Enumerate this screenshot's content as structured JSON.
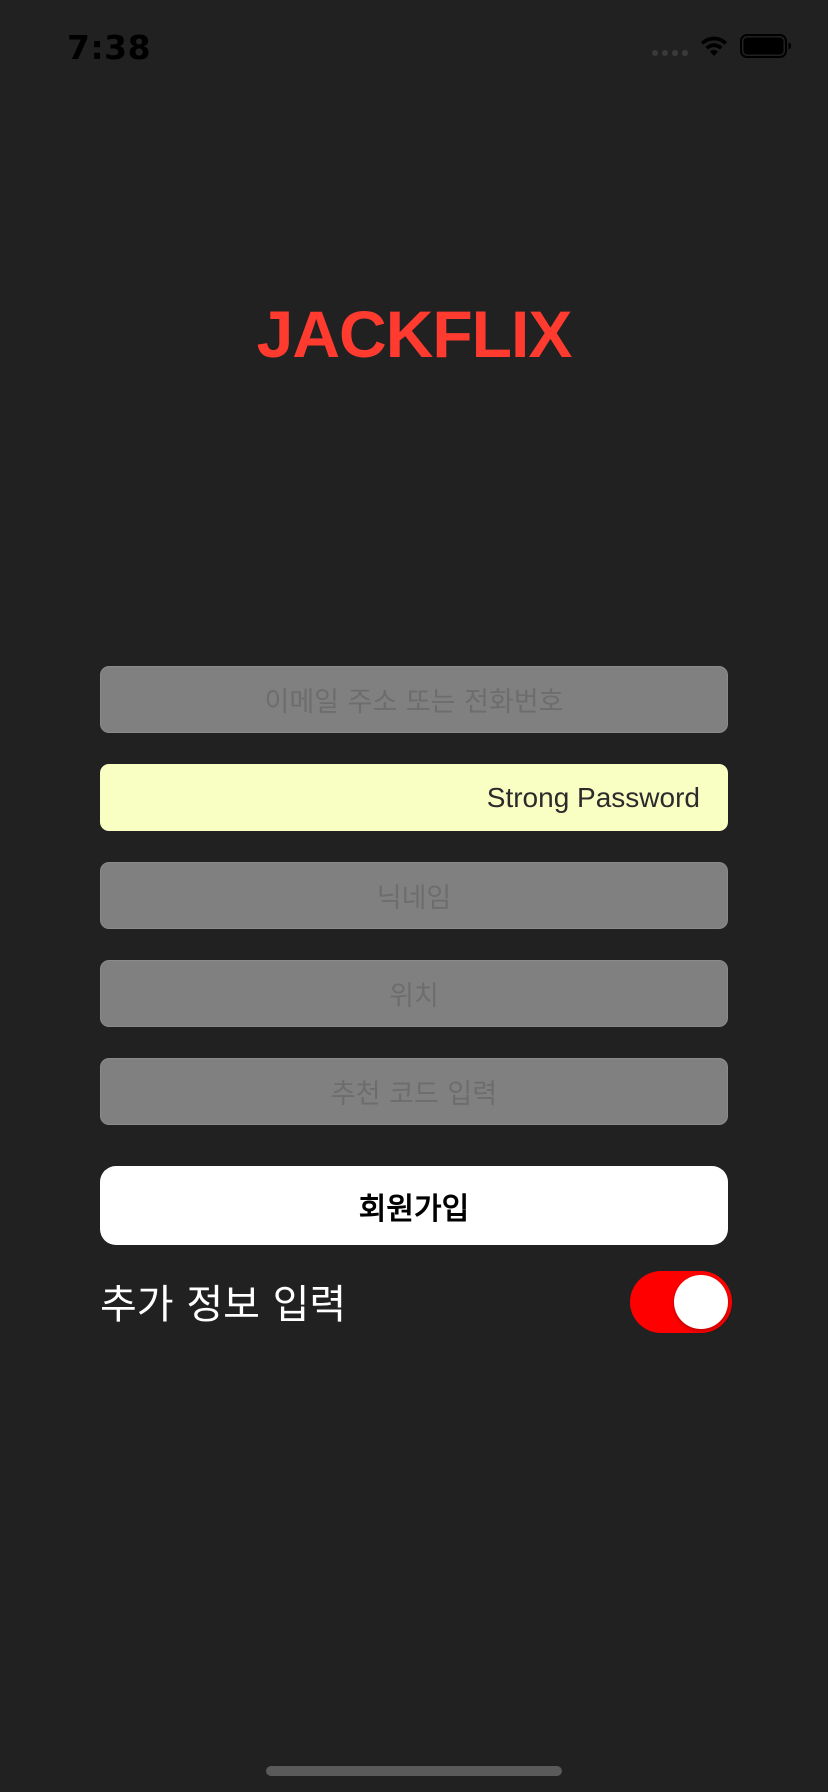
{
  "status_bar": {
    "time": "7:38"
  },
  "app": {
    "logo": "JACKFLIX",
    "brand_color": "#ff3b30"
  },
  "form": {
    "email": {
      "value": "",
      "placeholder": "이메일 주소 또는 전화번호"
    },
    "password": {
      "value": "Strong Password",
      "placeholder": ""
    },
    "nickname": {
      "value": "",
      "placeholder": "닉네임"
    },
    "location": {
      "value": "",
      "placeholder": "위치"
    },
    "referral_code": {
      "value": "",
      "placeholder": "추천 코드 입력"
    },
    "signup_label": "회원가입"
  },
  "extra_info": {
    "label": "추가 정보 입력",
    "toggle_on": true,
    "toggle_color": "#ff0000"
  },
  "icons": [
    "cellular-signal-icon",
    "wifi-icon",
    "battery-icon"
  ]
}
